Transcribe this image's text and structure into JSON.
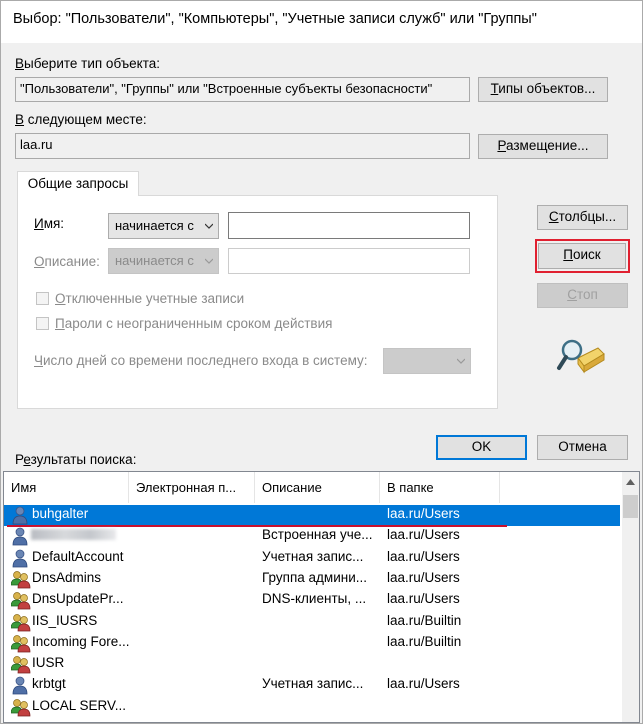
{
  "window": {
    "title": "Выбор: \"Пользователи\", \"Компьютеры\", \"Учетные записи служб\" или \"Группы\""
  },
  "object_type": {
    "label_prefix": "В",
    "label_rest": "ыберите тип объекта:",
    "value": "\"Пользователи\", \"Группы\" или \"Встроенные субъекты безопасности\"",
    "button_u": "Т",
    "button_rest": "ипы объектов..."
  },
  "location": {
    "label_prefix": "В",
    "label_rest": " следующем месте:",
    "value": "laa.ru",
    "button_u": "Р",
    "button_rest": "азмещение..."
  },
  "tab": {
    "label": "Общие запросы"
  },
  "query": {
    "name_label_u": "И",
    "name_label_rest": "мя:",
    "name_mode": "начинается с",
    "desc_label_u": "О",
    "desc_label_rest": "писание:",
    "desc_mode": "начинается с",
    "disabled_accounts": "Отключенные учетные записи",
    "disabled_accounts_u": "О",
    "disabled_accounts_rest": "тключенные учетные записи",
    "nonexpiring_u": "П",
    "nonexpiring_rest": "ароли с неограниченным сроком действия",
    "days_u": "Ч",
    "days_rest": "исло дней со времени последнего входа в систему:"
  },
  "buttons": {
    "columns_u": "С",
    "columns_rest": "толбцы...",
    "search_u": "П",
    "search_rest": "оиск",
    "stop_u": "С",
    "stop_rest": "топ",
    "ok": "OK",
    "cancel": "Отмена"
  },
  "results": {
    "label_prefix": "Р",
    "label_u": "е",
    "label_rest": "зультаты поиска:",
    "columns": [
      "Имя",
      "Электронная п...",
      "Описание",
      "В папке"
    ],
    "rows": [
      {
        "name": "buhgalter",
        "email": "",
        "description": "",
        "folder": "laa.ru/Users",
        "icon": "user-icon",
        "selected": true
      },
      {
        "name": "",
        "email": "",
        "description": "Встроенная уче...",
        "folder": "laa.ru/Users",
        "icon": "user-icon",
        "selected": false
      },
      {
        "name": "DefaultAccount",
        "email": "",
        "description": "Учетная запис...",
        "folder": "laa.ru/Users",
        "icon": "user-icon",
        "selected": false
      },
      {
        "name": "DnsAdmins",
        "email": "",
        "description": "Группа админи...",
        "folder": "laa.ru/Users",
        "icon": "group-icon",
        "selected": false
      },
      {
        "name": "DnsUpdatePr...",
        "email": "",
        "description": "DNS-клиенты, ...",
        "folder": "laa.ru/Users",
        "icon": "group-icon",
        "selected": false
      },
      {
        "name": "IIS_IUSRS",
        "email": "",
        "description": "",
        "folder": "laa.ru/Builtin",
        "icon": "group-icon",
        "selected": false
      },
      {
        "name": "Incoming Fore...",
        "email": "",
        "description": "",
        "folder": "laa.ru/Builtin",
        "icon": "group-icon",
        "selected": false
      },
      {
        "name": "IUSR",
        "email": "",
        "description": "",
        "folder": "",
        "icon": "group-icon",
        "selected": false
      },
      {
        "name": "krbtgt",
        "email": "",
        "description": "Учетная запис...",
        "folder": "laa.ru/Users",
        "icon": "user-icon",
        "selected": false
      },
      {
        "name": "LOCAL SERV...",
        "email": "",
        "description": "",
        "folder": "",
        "icon": "group-icon",
        "selected": false
      }
    ]
  },
  "colors": {
    "accent": "#0078d7",
    "highlight": "#e02030"
  }
}
